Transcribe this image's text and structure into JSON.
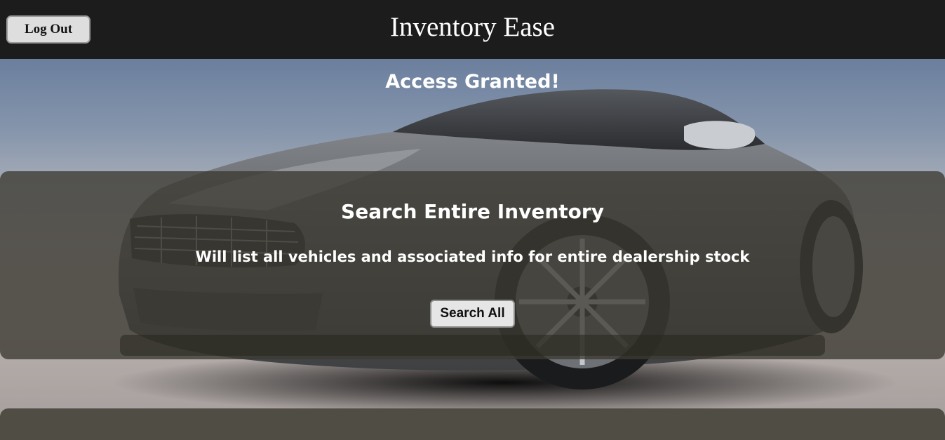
{
  "header": {
    "title": "Inventory Ease",
    "logout_label": "Log Out"
  },
  "banner": {
    "access_message": "Access Granted!"
  },
  "search_panel": {
    "heading": "Search Entire Inventory",
    "description": "Will list all vehicles and associated info for entire dealership stock",
    "button_label": "Search All"
  },
  "background": {
    "image": "silver-sports-car-photo"
  },
  "colors": {
    "header_bg": "#1c1c1c",
    "panel_overlay": "#3c3a32",
    "button_bg": "#e6e6e6",
    "text": "#ffffff"
  }
}
